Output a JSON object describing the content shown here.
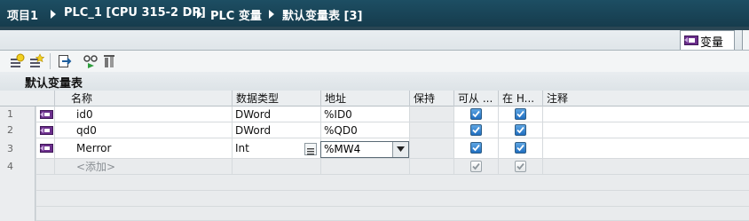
{
  "breadcrumb": [
    "项目1",
    "PLC_1 [CPU 315-2 DP]",
    "PLC 变量",
    "默认变量表 [3]"
  ],
  "tabs": {
    "active_label": "变量"
  },
  "toolbar": {
    "icons": [
      "add-tag-icon",
      "insert-row-icon",
      "export-icon",
      "monitor-icon",
      "delete-unused-icon"
    ]
  },
  "table": {
    "title": "默认变量表",
    "columns": [
      "名称",
      "数据类型",
      "地址",
      "保持",
      "可从 ...",
      "在 H...",
      "注释"
    ],
    "rows": [
      {
        "num": "1",
        "name": "id0",
        "type": "DWord",
        "address": "%ID0",
        "retain": false,
        "hmi_access": true,
        "hmi_visible": true
      },
      {
        "num": "2",
        "name": "qd0",
        "type": "DWord",
        "address": "%QD0",
        "retain": false,
        "hmi_access": true,
        "hmi_visible": true
      },
      {
        "num": "3",
        "name": "Merror",
        "type": "Int",
        "address": "%MW4",
        "retain": false,
        "hmi_access": true,
        "hmi_visible": true,
        "editing": true
      },
      {
        "num": "4",
        "name": "<添加>",
        "type": "",
        "address": "",
        "retain": false,
        "hmi_access": true,
        "hmi_visible": true,
        "placeholder": true
      }
    ]
  },
  "colors": {
    "titlebar": "#1d4e63",
    "checkbox": "#1f6ec0",
    "tag_icon": "#6b2e8c"
  }
}
